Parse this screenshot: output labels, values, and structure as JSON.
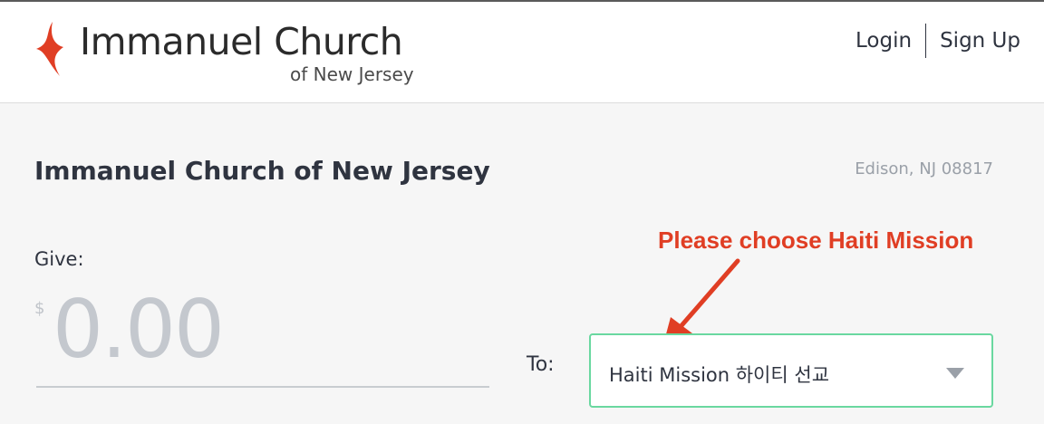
{
  "header": {
    "logo": {
      "title": "Immanuel Church",
      "subtitle": "of New Jersey",
      "mark_color": "#e03e24"
    },
    "login_label": "Login",
    "signup_label": "Sign Up"
  },
  "main": {
    "org_name": "Immanuel Church of New Jersey",
    "location": "Edison, NJ 08817",
    "callout": {
      "text": "Please choose Haiti Mission",
      "color": "#e03e24"
    },
    "give": {
      "label": "Give:",
      "currency_symbol": "$",
      "amount_placeholder": "0.00"
    },
    "to": {
      "label": "To:",
      "selected_fund": "Haiti Mission 하이티 선교",
      "border_color": "#6ad8a0"
    }
  },
  "icons": {
    "logo_mark": "flame-icon",
    "dropdown": "caret-down-icon",
    "callout_arrow": "arrow-icon"
  }
}
